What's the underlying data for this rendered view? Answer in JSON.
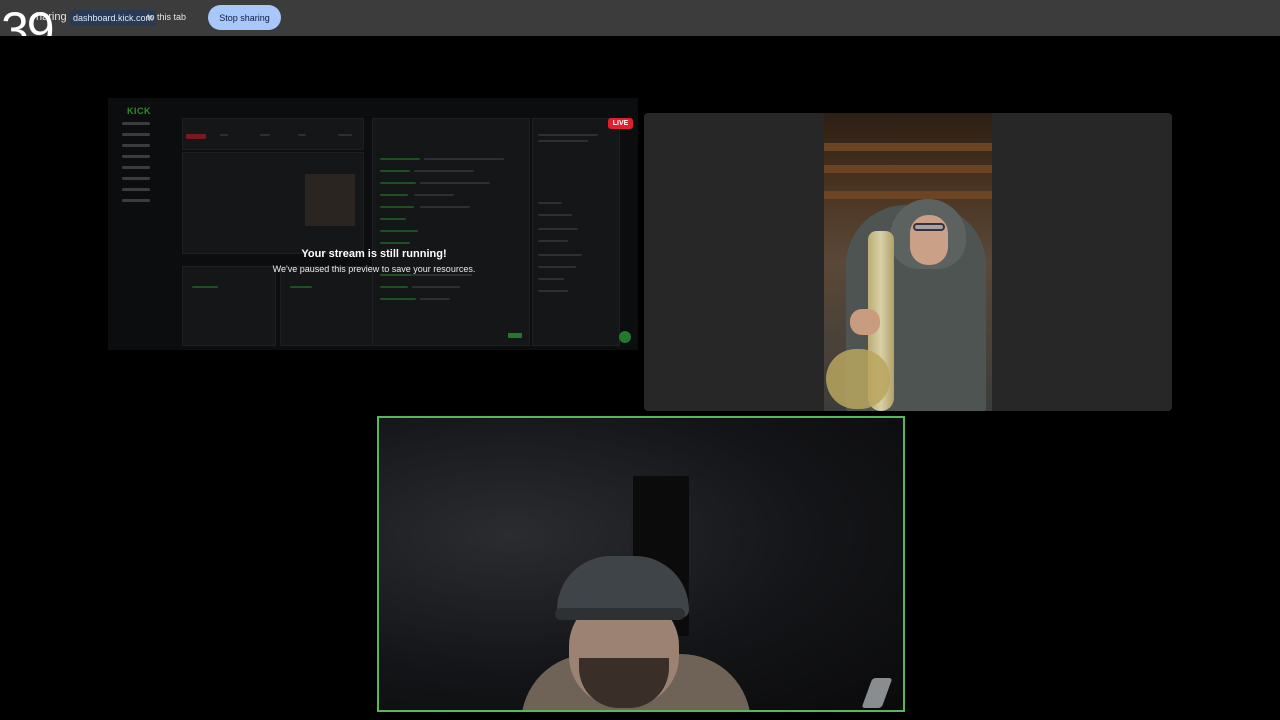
{
  "share_bar": {
    "prefix": "haring",
    "domain": "dashboard.kick.com",
    "suffix": "to this tab",
    "stop_button": "Stop sharing"
  },
  "counter": "39",
  "screen_share": {
    "live_badge": "LIVE",
    "notice_title": "Your stream is still running!",
    "notice_subtitle": "We've paused this preview to save your resources."
  },
  "colors": {
    "live_red": "#e0202e",
    "active_speaker_border": "#55b85c",
    "stop_button_bg": "#a8c7fa",
    "share_bar_bg": "#3c3c3c"
  }
}
